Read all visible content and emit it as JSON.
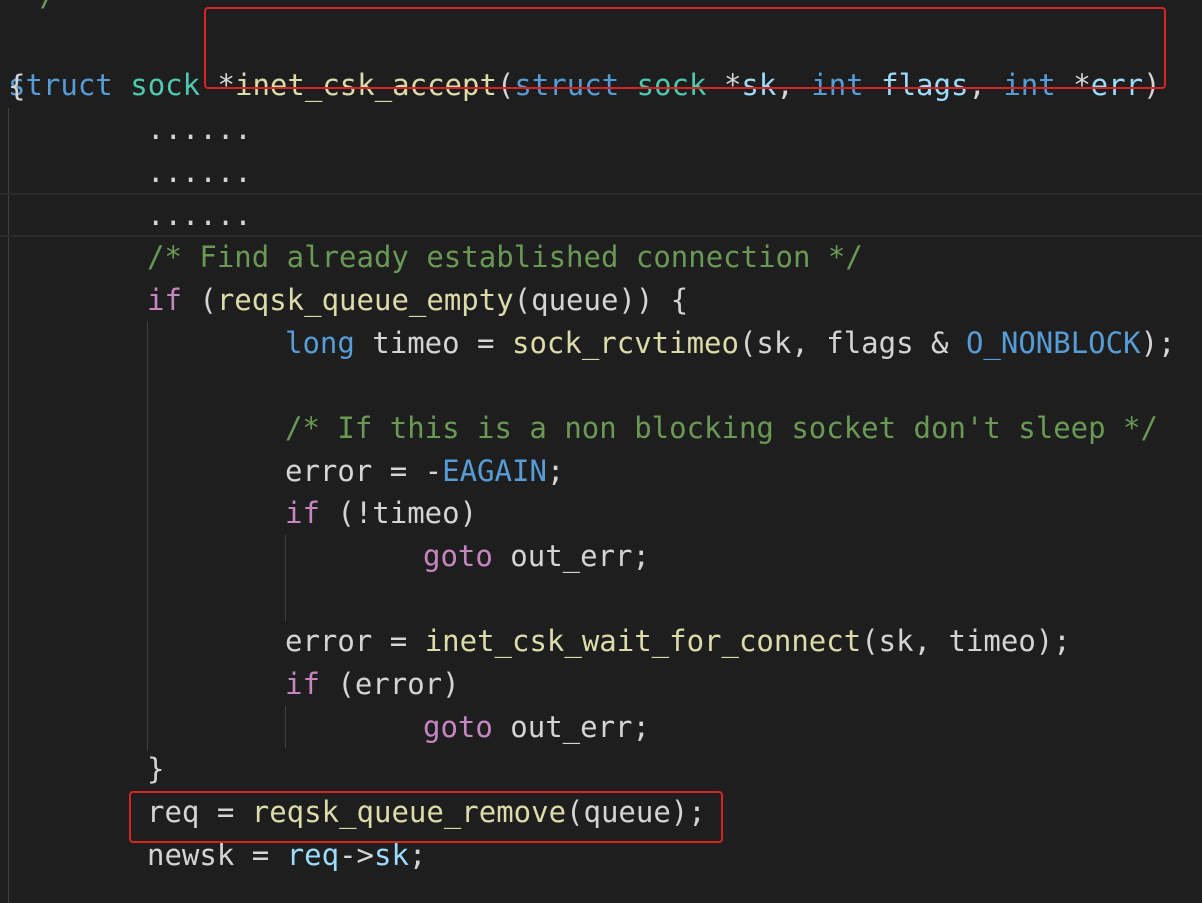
{
  "code": {
    "top_fragment": "*/",
    "sig": {
      "struct1": "struct",
      "sock1": "sock",
      "star_fn": "*",
      "fn_name": "inet_csk_accept",
      "paren_open": "(",
      "struct2": "struct",
      "sock2": "sock",
      "star_sk": "*",
      "sk": "sk",
      "comma1": ", ",
      "int1": "int",
      "flags": "flags",
      "comma2": ", ",
      "int2": "int",
      "star_err": "*",
      "err": "err",
      "paren_close": ")"
    },
    "brace_open": "{",
    "dots1": "......",
    "dots2": "......",
    "dots3": "......",
    "comment1": "/* Find already established connection */",
    "if1_kw": "if",
    "if1_open": " (",
    "if1_fn": "reqsk_queue_empty",
    "if1_rest": "(queue)) {",
    "long_kw": "long",
    "long_rest1": " timeo = ",
    "long_fn": "sock_rcvtimeo",
    "long_rest2": "(sk, flags & ",
    "long_mac": "O_NONBLOCK",
    "long_rest3": ");",
    "comment2": "/* If this is a non blocking socket don't sleep */",
    "err_assign1": "error = -",
    "eagain": "EAGAIN",
    "semi1": ";",
    "if2_kw": "if",
    "if2_rest": " (!timeo)",
    "goto1_kw": "goto",
    "goto1_rest": " out_err;",
    "err_assign2": "error = ",
    "wait_fn": "inet_csk_wait_for_connect",
    "wait_rest": "(sk, timeo);",
    "if3_kw": "if",
    "if3_rest": " (error)",
    "goto2_kw": "goto",
    "goto2_rest": " out_err;",
    "brace_close_inner": "}",
    "req_assign": "req = ",
    "remove_fn": "reqsk_queue_remove",
    "remove_rest": "(queue);",
    "newsk_assign": "newsk = ",
    "req_ptr": "req",
    "arrow": "->",
    "sk_field": "sk",
    "final_semi": ";"
  },
  "colors": {
    "background": "#1e1e1e",
    "keyword": "#569cd6",
    "type": "#4ec9b0",
    "function": "#dcdcaa",
    "param": "#9cdcfe",
    "comment": "#6a9955",
    "control": "#c586c0",
    "highlight_box": "#d42424"
  }
}
